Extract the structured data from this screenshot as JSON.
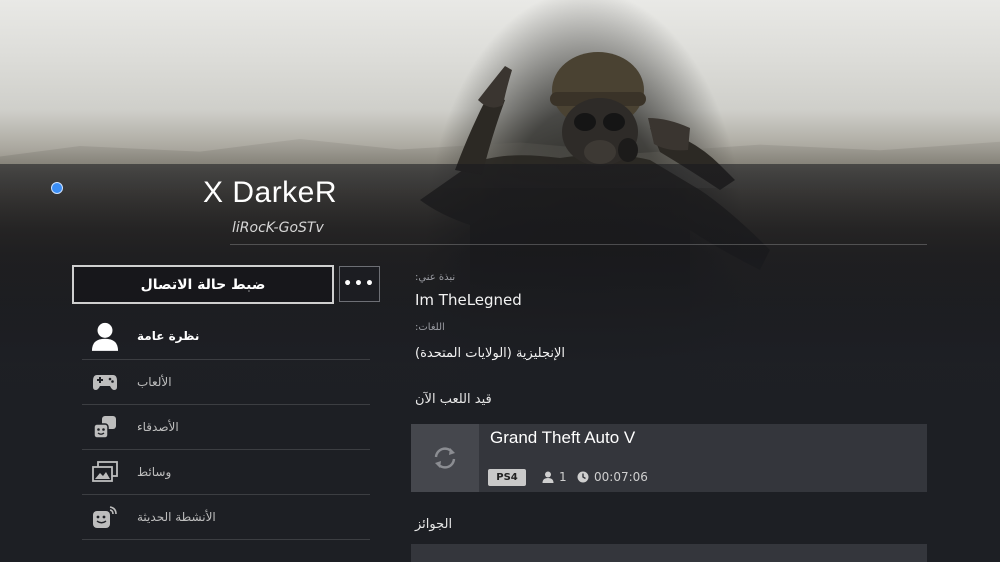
{
  "profile": {
    "online_id": "X DarkeR",
    "real_name": "liRocK-GoSTv",
    "status_color": "#3b8ef5"
  },
  "actions": {
    "set_status_label": "ضبط حالة الاتصال",
    "more_label": "•••"
  },
  "menu": {
    "items": [
      {
        "label": "نظرة عامة",
        "icon": "avatar-icon",
        "active": true
      },
      {
        "label": "الألعاب",
        "icon": "controller-icon",
        "active": false
      },
      {
        "label": "الأصدقاء",
        "icon": "friends-icon",
        "active": false
      },
      {
        "label": "وسائط",
        "icon": "media-icon",
        "active": false
      },
      {
        "label": "الأنشطة الحديثة",
        "icon": "activity-icon",
        "active": false
      }
    ]
  },
  "about": {
    "about_label": "نبذة عني:",
    "about_value": "Im TheLegned",
    "languages_label": "اللغات:",
    "languages_value": "الإنجليزية (الولايات المتحدة)"
  },
  "now_playing": {
    "title": "قيد اللعب الآن",
    "game_title": "Grand Theft Auto V",
    "platform": "PS4",
    "players": "1",
    "time": "00:07:06"
  },
  "trophies": {
    "title": "الجوائز"
  }
}
